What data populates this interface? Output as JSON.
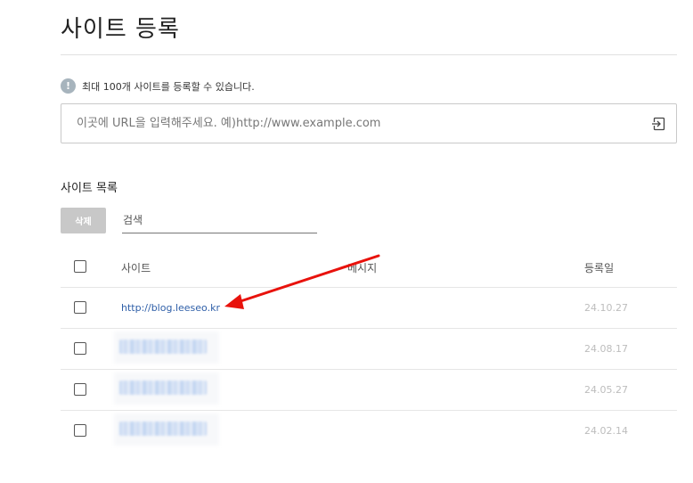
{
  "page": {
    "title": "사이트 등록"
  },
  "notice": {
    "icon": "info-icon",
    "text": "최대 100개 사이트를 등록할 수 있습니다."
  },
  "url_input": {
    "placeholder": "이곳에 URL을 입력해주세요. 예)http://www.example.com",
    "value": "",
    "submit_icon": "enter-icon"
  },
  "site_list": {
    "title": "사이트 목록",
    "delete_label": "삭제",
    "search_placeholder": "검색",
    "columns": {
      "site": "사이트",
      "message": "메시지",
      "date": "등록일"
    },
    "rows": [
      {
        "site": "http://blog.leeseo.kr",
        "message": "",
        "date": "24.10.27",
        "blurred": false
      },
      {
        "site": "",
        "message": "",
        "date": "24.08.17",
        "blurred": true
      },
      {
        "site": "",
        "message": "",
        "date": "24.05.27",
        "blurred": true
      },
      {
        "site": "",
        "message": "",
        "date": "24.02.14",
        "blurred": true
      }
    ]
  },
  "annotation": {
    "color": "#e8120c",
    "points_to": "http://blog.leeseo.kr"
  },
  "colors": {
    "link": "#2f5fa8",
    "delete_button": "#c8c8c8",
    "info_icon": "#a7b4bd"
  }
}
